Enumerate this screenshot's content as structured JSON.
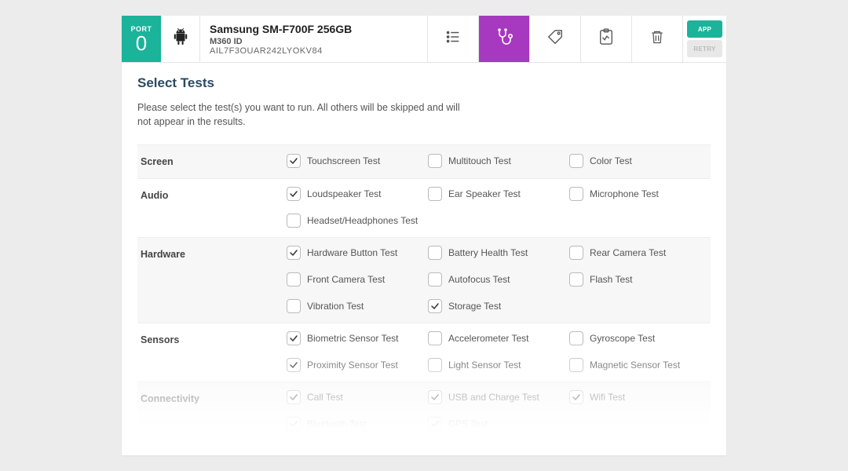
{
  "header": {
    "port_label": "PORT",
    "port_number": "0",
    "device_model": "Samsung SM-F700F 256GB",
    "m360_label": "M360 ID",
    "m360_id": "AIL7F3OUAR242LYOKV84",
    "app_btn": "APP",
    "retry_btn": "RETRY"
  },
  "title": "Select Tests",
  "instructions": "Please select the test(s) you want to run. All others will be skipped and will not appear in the results.",
  "sections": [
    {
      "name": "Screen",
      "alt": true,
      "tests": [
        {
          "label": "Touchscreen Test",
          "checked": true
        },
        {
          "label": "Multitouch Test",
          "checked": false
        },
        {
          "label": "Color Test",
          "checked": false
        }
      ]
    },
    {
      "name": "Audio",
      "alt": false,
      "tests": [
        {
          "label": "Loudspeaker Test",
          "checked": true
        },
        {
          "label": "Ear Speaker Test",
          "checked": false
        },
        {
          "label": "Microphone Test",
          "checked": false
        },
        {
          "label": "Headset/Headphones Test",
          "checked": false
        }
      ]
    },
    {
      "name": "Hardware",
      "alt": true,
      "tests": [
        {
          "label": "Hardware Button Test",
          "checked": true
        },
        {
          "label": "Battery Health Test",
          "checked": false
        },
        {
          "label": "Rear Camera Test",
          "checked": false
        },
        {
          "label": "Front Camera Test",
          "checked": false
        },
        {
          "label": "Autofocus Test",
          "checked": false
        },
        {
          "label": "Flash Test",
          "checked": false
        },
        {
          "label": "Vibration Test",
          "checked": false
        },
        {
          "label": "Storage Test",
          "checked": true
        }
      ]
    },
    {
      "name": "Sensors",
      "alt": false,
      "tests": [
        {
          "label": "Biometric Sensor Test",
          "checked": true
        },
        {
          "label": "Accelerometer Test",
          "checked": false
        },
        {
          "label": "Gyroscope Test",
          "checked": false
        },
        {
          "label": "Proximity Sensor Test",
          "checked": true
        },
        {
          "label": "Light Sensor Test",
          "checked": false
        },
        {
          "label": "Magnetic Sensor Test",
          "checked": false
        }
      ]
    },
    {
      "name": "Connectivity",
      "alt": true,
      "tests": [
        {
          "label": "Call Test",
          "checked": true
        },
        {
          "label": "USB and Charge Test",
          "checked": true
        },
        {
          "label": "Wifi Test",
          "checked": true
        },
        {
          "label": "Bluetooth Test",
          "checked": true
        },
        {
          "label": "GPS Test",
          "checked": true
        }
      ]
    }
  ]
}
